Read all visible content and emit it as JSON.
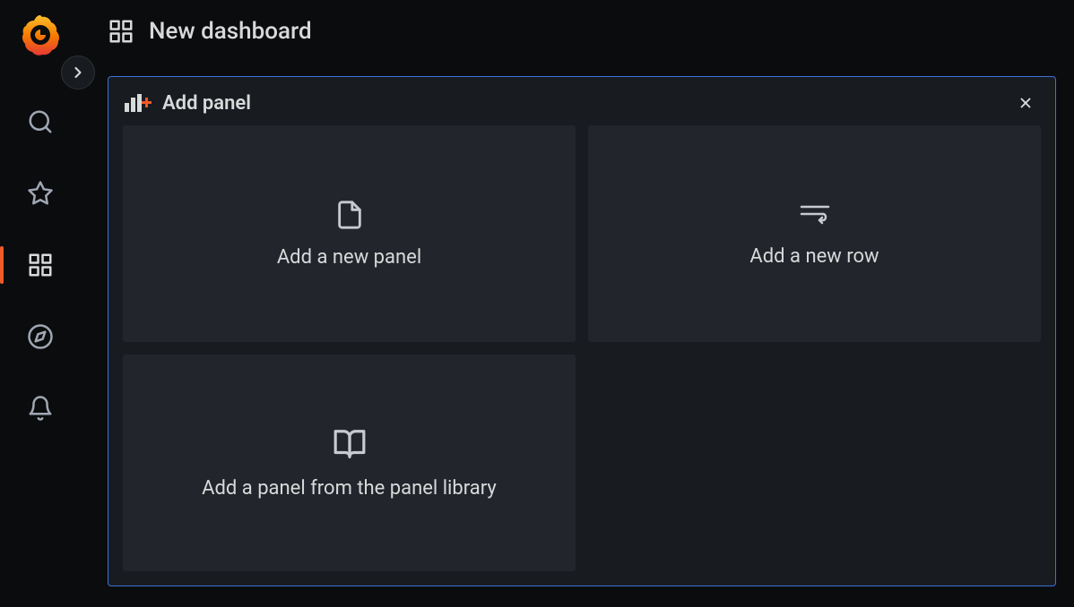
{
  "header": {
    "title": "New dashboard"
  },
  "addPanel": {
    "title": "Add panel",
    "options": {
      "newPanel": "Add a new panel",
      "newRow": "Add a new row",
      "panelLibrary": "Add a panel from the panel library"
    }
  }
}
